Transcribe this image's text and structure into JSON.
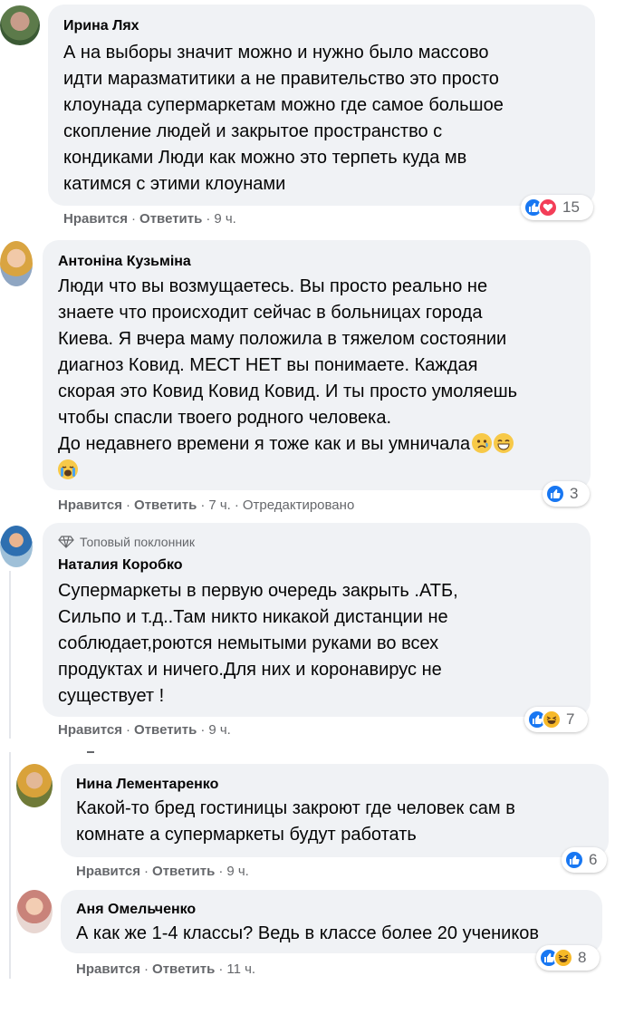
{
  "comments": [
    {
      "author": "Ирина Лях",
      "lines": [
        "А на выборы значит можно и нужно было массово",
        "идти маразматитики а не правительство это просто",
        "клоунада супермаркетам можно где самое большое",
        "скопление людей и закрытое пространство с",
        "кондиками Люди как можно это терпеть куда мв",
        "катимся с этими клоунами"
      ],
      "like": "Нравится",
      "reply": "Ответить",
      "time": "9 ч.",
      "reactions": [
        "like",
        "love"
      ],
      "reaction_count": "15"
    },
    {
      "author": "Антоніна Кузьміна",
      "lines": [
        "Люди что вы возмущаетесь. Вы просто реально не",
        "знаете что происходит сейчас в больницах города",
        "Киева. Я вчера маму положила в тяжелом состоянии",
        "диагноз Ковид. МЕСТ НЕТ вы понимаете. Каждая",
        "скорая это Ковид Ковид Ковид. И ты просто умоляешь",
        "чтобы спасли твоего родного человека.",
        "До недавнего времени я тоже как и вы умничала"
      ],
      "emojis": [
        "sad-face-emoji",
        "grin-face-emoji",
        "crying-face-emoji"
      ],
      "like": "Нравится",
      "reply": "Ответить",
      "time": "7 ч.",
      "edited": "Отредактировано",
      "reactions": [
        "like"
      ],
      "reaction_count": "3"
    },
    {
      "badge": "Топовый поклонник",
      "author": "Наталия Коробко",
      "lines": [
        "Супермаркеты в первую очередь закрыть .АТБ,",
        "Сильпо и т.д..Там никто никакой дистанции не",
        "соблюдает,роются немытыми руками во всех",
        "продуктах и ничего.Для них и коронавирус не",
        "существует !"
      ],
      "like": "Нравится",
      "reply": "Ответить",
      "time": "9 ч.",
      "reactions": [
        "like",
        "haha"
      ],
      "reaction_count": "7"
    }
  ],
  "replies": [
    {
      "author": "Нина Лементаренко",
      "lines": [
        "Какой-то бред гостиницы закроют где человек сам в",
        "комнате а супермаркеты будут работать"
      ],
      "like": "Нравится",
      "reply": "Ответить",
      "time": "9 ч.",
      "reactions": [
        "like"
      ],
      "reaction_count": "6"
    },
    {
      "author": "Аня Омельченко",
      "lines": [
        "А как же 1-4 классы? Ведь в классе более 20 учеников"
      ],
      "like": "Нравится",
      "reply": "Ответить",
      "time": "11 ч.",
      "reactions": [
        "like",
        "haha"
      ],
      "reaction_count": "8"
    }
  ],
  "colors": {
    "bubble": "#f0f2f5",
    "like_blue": "#1877f2",
    "love_red": "#f33e58",
    "haha_yellow": "#f7b928",
    "meta_gray": "#65676b"
  }
}
